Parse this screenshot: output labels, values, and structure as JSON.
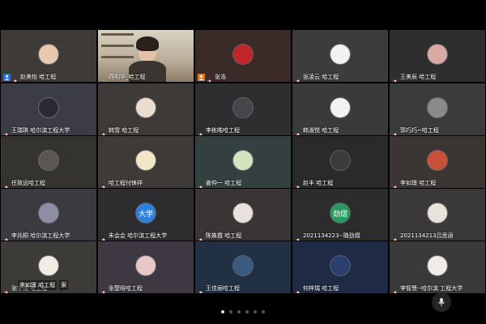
{
  "tiles": [
    {
      "name": "赵美怡 哈工程",
      "bg": "#3e3a38",
      "avatar": "#e8c9b0",
      "badge": "host-icon"
    },
    {
      "name": "燕明华_哈工程",
      "bg": "#c7bca9",
      "video": true,
      "active": true
    },
    {
      "name": "张浩",
      "bg": "#3a2a28",
      "avatar": "#c0262a",
      "badge": "cohost-icon"
    },
    {
      "name": "张凌云 哈工程",
      "bg": "#3c3c3c",
      "avatar": "#f2f2f2"
    },
    {
      "name": "王美辰 哈工程",
      "bg": "#2f2e2f",
      "avatar": "#d9a9a3"
    },
    {
      "name": "王瑞琪 哈尔滨工程大学",
      "bg": "#3b3c45",
      "avatar": "#2a2a35"
    },
    {
      "name": "韩雪 哈工程",
      "bg": "#3d3a37",
      "avatar": "#e8ddd0"
    },
    {
      "name": "李栋皓哈工程",
      "bg": "#2e2e30",
      "avatar": "#46464a"
    },
    {
      "name": "韩淑悦 哈工程",
      "bg": "#3a3a3a",
      "avatar": "#f3f3f3"
    },
    {
      "name": "郭巧巧~哈工程",
      "bg": "#3b3b3b",
      "avatar": "#8a8a8a"
    },
    {
      "name": "任致远哈工程",
      "bg": "#35332f",
      "avatar": "#5b5650"
    },
    {
      "name": "哈工程付锋祥",
      "bg": "#3e3a37",
      "avatar": "#f1e6c5"
    },
    {
      "name": "姜仲一 哈工程",
      "bg": "#344040",
      "avatar": "#d5e3c0"
    },
    {
      "name": "赵丰 哈工程",
      "bg": "#2a2a2a",
      "avatar": "#3b3b3b"
    },
    {
      "name": "李如璟 哈工程",
      "bg": "#3b3533",
      "avatar": "#c8503a"
    },
    {
      "name": "李兆桐 哈尔滨工程大学",
      "bg": "#3a3a40",
      "avatar": "#8e8ea6"
    },
    {
      "name": "朱会会 哈尔滨工程大学",
      "bg": "#2d2d2f",
      "avatar_text": "大学",
      "avatar": "#2f7fe0"
    },
    {
      "name": "陈姝霞 哈工程",
      "bg": "#3a3535",
      "avatar": "#e9e2dc"
    },
    {
      "name": "2021134223--璐劲熠",
      "bg": "#2c2c2c",
      "avatar_text": "劲熠",
      "avatar": "#2c9a5e"
    },
    {
      "name": "2021134213吕思涵",
      "bg": "#3a3838",
      "avatar": "#e8e3da"
    },
    {
      "name": "张宇瑞  哈工程",
      "bg": "#3d3b38",
      "avatar": "#f0ece4"
    },
    {
      "name": "张楚晗哈工程",
      "bg": "#3e3842",
      "avatar": "#e7c8c6"
    },
    {
      "name": "王佳丽哈工程",
      "bg": "#223044",
      "avatar": "#3a5a80"
    },
    {
      "name": "何梓瑞  哈工程",
      "bg": "#1f2a45",
      "avatar": "#2a3f6e"
    },
    {
      "name": "李智慧--哈尔滨 工程大学",
      "bg": "#3a3a3a",
      "avatar": "#f0ebe6"
    }
  ],
  "overlay": {
    "tag1": "李如璟 哈工程",
    "tag2": "案"
  },
  "pager": {
    "count": 6,
    "current": 0
  },
  "colors": {
    "active_border": "#3cc46a",
    "host_badge": "#2d74d8",
    "cohost_badge": "#e07a2a"
  }
}
